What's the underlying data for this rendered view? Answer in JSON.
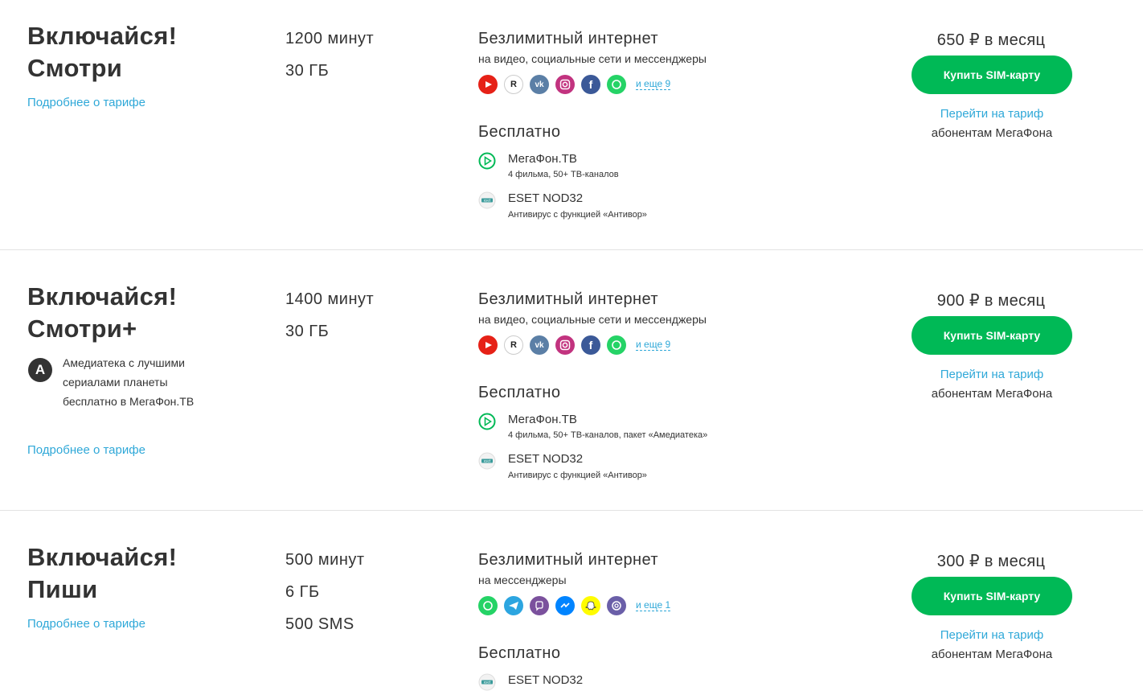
{
  "tariffs": [
    {
      "name_line1": "Включайся!",
      "name_line2": "Смотри",
      "details_link": "Подробнее о тарифе",
      "amounts": [
        "1200 минут",
        "30 ГБ"
      ],
      "internet_title": "Безлимитный интернет",
      "internet_sub": "на видео, социальные сети и мессенджеры",
      "apps": [
        "youtube",
        "rutube",
        "vk",
        "instagram",
        "facebook",
        "whatsapp"
      ],
      "more": "и еще 9",
      "free_title": "Бесплатно",
      "services": [
        {
          "icon": "megafon-tv",
          "name": "МегаФон.ТВ",
          "desc": "4 фильма, 50+ ТВ-каналов"
        },
        {
          "icon": "eset",
          "name": "ESET NOD32",
          "desc": "Антивирус с функцией «Антивор»"
        }
      ],
      "price": "650 ₽ в месяц",
      "buy": "Купить SIM-карту",
      "switch": "Перейти на тариф",
      "subscribers": "абонентам МегаФона"
    },
    {
      "name_line1": "Включайся!",
      "name_line2": "Смотри+",
      "badge_letter": "A",
      "badge_text": "Амедиатека с лучшими сериалами планеты бесплатно в МегаФон.ТВ",
      "details_link": "Подробнее о тарифе",
      "amounts": [
        "1400 минут",
        "30 ГБ"
      ],
      "internet_title": "Безлимитный интернет",
      "internet_sub": "на видео, социальные сети и мессенджеры",
      "apps": [
        "youtube",
        "rutube",
        "vk",
        "instagram",
        "facebook",
        "whatsapp"
      ],
      "more": "и еще 9",
      "free_title": "Бесплатно",
      "services": [
        {
          "icon": "megafon-tv",
          "name": "МегаФон.ТВ",
          "desc": "4 фильма, 50+ ТВ-каналов, пакет «Амедиатека»"
        },
        {
          "icon": "eset",
          "name": "ESET NOD32",
          "desc": "Антивирус с функцией «Антивор»"
        }
      ],
      "price": "900 ₽ в месяц",
      "buy": "Купить SIM-карту",
      "switch": "Перейти на тариф",
      "subscribers": "абонентам МегаФона"
    },
    {
      "name_line1": "Включайся!",
      "name_line2": "Пиши",
      "details_link": "Подробнее о тарифе",
      "amounts": [
        "500 минут",
        "6 ГБ",
        "500 SMS"
      ],
      "internet_title": "Безлимитный интернет",
      "internet_sub": "на мессенджеры",
      "apps": [
        "whatsapp",
        "telegram",
        "viber",
        "messenger",
        "snapchat",
        "tamtam"
      ],
      "more": "и еще 1",
      "free_title": "Бесплатно",
      "services": [
        {
          "icon": "eset",
          "name": "ESET NOD32",
          "desc": ""
        }
      ],
      "price": "300 ₽ в месяц",
      "buy": "Купить SIM-карту",
      "switch": "Перейти на тариф",
      "subscribers": "абонентам МегаФона"
    }
  ],
  "colors": {
    "accent": "#00b956",
    "link": "#2fa8d8",
    "text": "#333333",
    "divider": "#e3e3e3"
  }
}
